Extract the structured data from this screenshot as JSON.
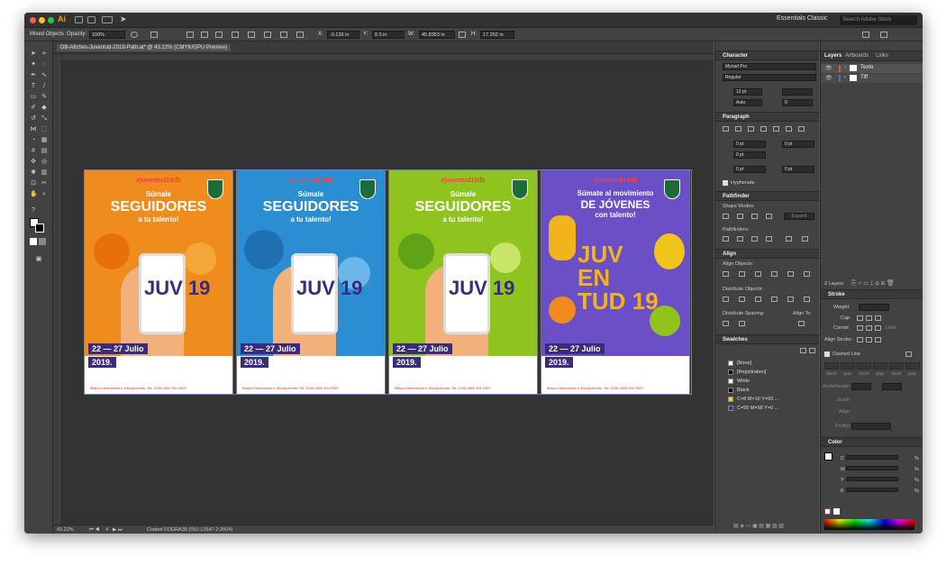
{
  "app": {
    "logo": "Ai",
    "workspace": "Essentials Classic",
    "search_placeholder": "Search Adobe Stock"
  },
  "control_bar": {
    "selection": "Mixed Objects",
    "opacity_label": "Opacity:",
    "opacity_value": "100%",
    "x_label": "X:",
    "x_value": "-0.126 in",
    "y_label": "Y:",
    "y_value": "8.5 in",
    "w_label": "W:",
    "w_value": "45.8353 in",
    "h_label": "H:",
    "h_value": "17.252 in"
  },
  "document": {
    "tab_title": "DB-Afiches-Juventud-2019-Path.ai* @ 43.22% (CMYK/GPU Preview)"
  },
  "posters": [
    {
      "tag": "#juventud19db",
      "line1": "Súmale",
      "line2": "SEGUIDORES",
      "line3": "a tu talento!",
      "date": "22 — 27 Julio",
      "year": "2019.",
      "bg": "#f08c1e",
      "juv": "JUV 19",
      "footer": "Mayor Información e Inscripciones: Tel: 2246-2600 Ext.2923"
    },
    {
      "tag": "#juventud19db",
      "line1": "Súmale",
      "line2": "SEGUIDORES",
      "line3": "a tu talento!",
      "date": "22 — 27 Julio",
      "year": "2019.",
      "bg": "#2b8ed3",
      "juv": "JUV 19",
      "footer": "Mayor Información e Inscripciones: Tel: 2246-2600 Ext.2923"
    },
    {
      "tag": "#juventud19db",
      "line1": "Súmale",
      "line2": "SEGUIDORES",
      "line3": "a tu talento!",
      "date": "22 — 27 Julio",
      "year": "2019.",
      "bg": "#8fc41f",
      "juv": "JUV 19",
      "footer": "Mayor Información e Inscripciones: Tel: 2246-2600 Ext.2923"
    },
    {
      "tag": "#juventud19db",
      "line1": "Súmate al movimiento",
      "line2": "DE JÓVENES",
      "line3": "con talento!",
      "date": "22 — 27 Julio",
      "year": "2019.",
      "bg": "#6a4fc6",
      "juv": "JUV EN TUD 19",
      "footer": "Mayor Información e Inscripciones: Tel: 2246-2600 Ext.2923"
    }
  ],
  "status_bar": {
    "zoom": "43.22%",
    "page": "4",
    "profile": "Coated FOGRA39 (ISO 12647-2:2004)"
  },
  "character": {
    "title": "Character",
    "font": "Myriad Pro",
    "style": "Regular",
    "size": "12 pt",
    "leading": "Auto",
    "kerning": "0"
  },
  "paragraph": {
    "title": "Paragraph",
    "indent_left": "0 pt",
    "indent_right": "0 pt",
    "first_line": "0 pt",
    "space_before": "0 pt",
    "space_after": "0 pt",
    "hyphenate": "Hyphenate"
  },
  "pathfinder": {
    "title": "Pathfinder",
    "shape_modes": "Shape Modes:",
    "expand": "Expand",
    "pathfinders": "Pathfinders:"
  },
  "align": {
    "title": "Align",
    "align_objects": "Align Objects:",
    "distribute_objects": "Distribute Objects:",
    "distribute_spacing": "Distribute Spacing:",
    "align_to": "Align To:"
  },
  "swatches": {
    "title": "Swatches",
    "items": [
      {
        "name": "[None]",
        "color": "#ffffff"
      },
      {
        "name": "[Registration]",
        "color": "#000000"
      },
      {
        "name": "White",
        "color": "#ffffff"
      },
      {
        "name": "Black",
        "color": "#000000"
      },
      {
        "name": "C=8 M=10 Y=93 ...",
        "color": "#ecd51c"
      },
      {
        "name": "C=95 M=98 Y=0 ...",
        "color": "#3b2b8f"
      }
    ]
  },
  "layers": {
    "tabs": [
      "Layers",
      "Artboards",
      "Links"
    ],
    "items": [
      {
        "name": "Texto",
        "color": "#e84c3d"
      },
      {
        "name": "Tiff",
        "color": "#4a6fd8"
      }
    ],
    "count": "2 Layers"
  },
  "stroke": {
    "title": "Stroke",
    "weight": "Weight:",
    "cap": "Cap:",
    "corner": "Corner:",
    "limit": "Limit:",
    "align_stroke": "Align Stroke:",
    "dashed_line": "Dashed Line",
    "dash_labels": [
      "dash",
      "gap",
      "dash",
      "gap",
      "dash",
      "gap"
    ],
    "arrowheads": "Arrowheads:",
    "scale": "Scale:",
    "align": "Align:",
    "profile": "Profile:"
  },
  "color": {
    "title": "Color",
    "channels": [
      "C",
      "M",
      "Y",
      "K"
    ],
    "pct": "%"
  }
}
